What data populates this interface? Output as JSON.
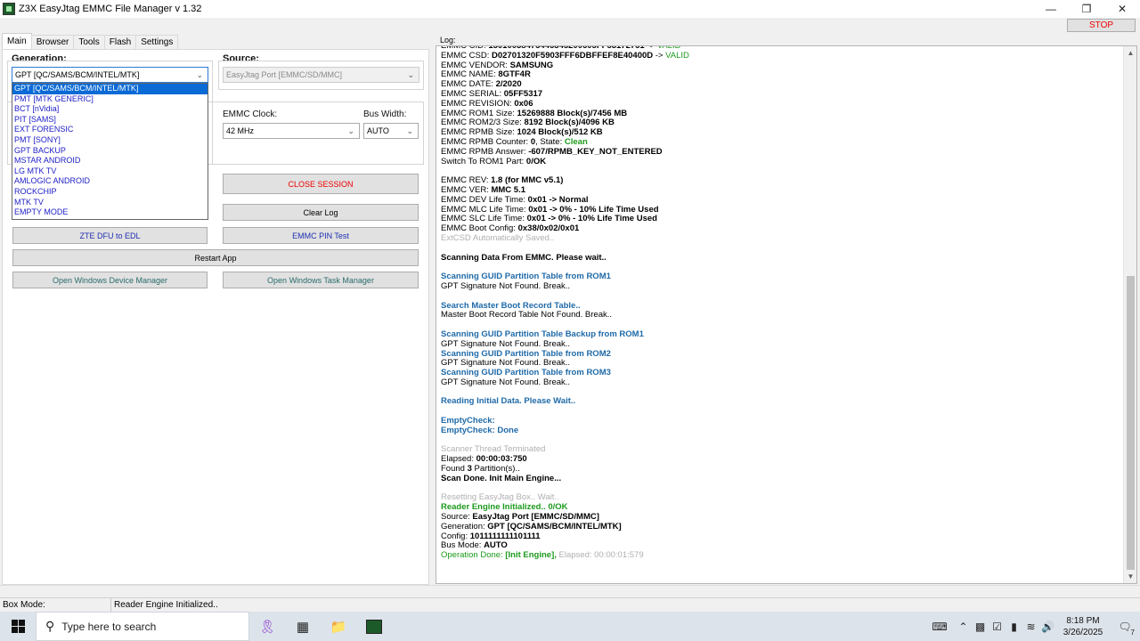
{
  "window": {
    "title": "Z3X EasyJtag EMMC File Manager v 1.32",
    "stop_label": "STOP"
  },
  "tabs": [
    "Main",
    "Browser",
    "Tools",
    "Flash",
    "Settings"
  ],
  "main": {
    "generation_label": "Generation:",
    "generation_value": "GPT [QC/SAMS/BCM/INTEL/MTK]",
    "generation_options": [
      "GPT [QC/SAMS/BCM/INTEL/MTK]",
      "PMT [MTK GENERIC]",
      "BCT [nVidia]",
      "PIT [SAMS]",
      "EXT FORENSIC",
      "PMT [SONY]",
      "GPT BACKUP",
      "MSTAR ANDROID",
      "LG MTK TV",
      "AMLOGIC ANDROID",
      "ROCKCHIP",
      "MTK TV",
      "EMPTY MODE"
    ],
    "source_label": "Source:",
    "source_value": "EasyJtag Port [EMMC/SD/MMC]",
    "emmc_clock_label": "EMMC Clock:",
    "emmc_clock_value": "42 MHz",
    "bus_width_label": "Bus Width:",
    "bus_width_value": "AUTO",
    "buttons": {
      "close_session": "CLOSE SESSION",
      "clear_log": "Clear Log",
      "zte_dfu": "ZTE DFU to EDL",
      "emmc_pin_test": "EMMC PIN Test",
      "restart_app": "Restart App",
      "device_manager": "Open Windows Device Manager",
      "task_manager": "Open Windows Task Manager"
    }
  },
  "log": {
    "label": "Log:",
    "lines": [
      {
        "k": "EMMC CID: ",
        "v": "15010038475446345200605FF53172751",
        "s": " -> ",
        "e": "VALID"
      },
      {
        "k": "EMMC CSD: ",
        "v": "D02701320F5903FFF6DBFFEF8E40400D",
        "s": " -> ",
        "e": "VALID"
      },
      {
        "k": "EMMC VENDOR: ",
        "v": "SAMSUNG"
      },
      {
        "k": "EMMC NAME: ",
        "v": "8GTF4R"
      },
      {
        "k": "EMMC DATE: ",
        "v": "2/2020"
      },
      {
        "k": "EMMC SERIAL: ",
        "v": "05FF5317"
      },
      {
        "k": "EMMC REVISION: ",
        "v": "0x06"
      },
      {
        "k": "EMMC ROM1 Size: ",
        "v": "15269888 Block(s)/7456 MB"
      },
      {
        "k": "EMMC ROM2/3 Size: ",
        "v": "8192 Block(s)/4096 KB"
      },
      {
        "k": "EMMC RPMB Size: ",
        "v": "1024 Block(s)/512 KB"
      },
      {
        "k": "EMMC RPMB Counter: ",
        "v": "0",
        "s": ", State: ",
        "g": "Clean"
      },
      {
        "k": "EMMC RPMB Answer: ",
        "v": "-607/RPMB_KEY_NOT_ENTERED"
      },
      {
        "k": "Switch To ROM1 Part: ",
        "v": "0/OK"
      },
      {
        "k": ""
      },
      {
        "k": "EMMC REV: ",
        "v": "1.8 (for MMC v5.1)"
      },
      {
        "k": "EMMC VER: ",
        "v": "MMC 5.1"
      },
      {
        "k": "EMMC DEV Life Time: ",
        "v": "0x01 -> Normal"
      },
      {
        "k": "EMMC MLC Life Time: ",
        "v": "0x01 -> 0% - 10% Life Time Used"
      },
      {
        "k": "EMMC SLC Life Time: ",
        "v": "0x01 -> 0% - 10% Life Time Used"
      },
      {
        "k": "EMMC Boot Config: ",
        "v": "0x38/0x02/0x01"
      },
      {
        "gray": "ExtCSD Automatically Saved.."
      },
      {
        "k": ""
      },
      {
        "bold": "Scanning Data From EMMC. Please wait.."
      },
      {
        "k": ""
      },
      {
        "blue": "Scanning GUID Partition Table from ROM1"
      },
      {
        "k": "GPT Signature Not Found. Break.."
      },
      {
        "k": ""
      },
      {
        "blue": "Search Master Boot Record Table.."
      },
      {
        "k": "Master Boot Record Table Not Found. Break.."
      },
      {
        "k": ""
      },
      {
        "blue": "Scanning GUID Partition Table Backup from ROM1"
      },
      {
        "k": "GPT Signature Not Found. Break.."
      },
      {
        "blue": "Scanning GUID Partition Table from ROM2"
      },
      {
        "k": "GPT Signature Not Found. Break.."
      },
      {
        "blue": "Scanning GUID Partition Table from ROM3"
      },
      {
        "k": "GPT Signature Not Found. Break.."
      },
      {
        "k": ""
      },
      {
        "blue": "Reading Initial Data. Please Wait.."
      },
      {
        "k": ""
      },
      {
        "blue": "EmptyCheck:"
      },
      {
        "blue": "EmptyCheck: Done"
      },
      {
        "k": ""
      },
      {
        "gray": "Scanner Thread Terminated"
      },
      {
        "k": "Elapsed: ",
        "v": "00:00:03:750"
      },
      {
        "k": "Found ",
        "v": "3",
        "s": " Partition(s).."
      },
      {
        "bold": "Scan Done. Init Main Engine..."
      },
      {
        "k": ""
      },
      {
        "gray": "Resetting EasyJtag Box.. Wait.."
      },
      {
        "greenb": "Reader Engine Initialized.. 0/OK"
      },
      {
        "k": "Source: ",
        "v": "EasyJtag Port [EMMC/SD/MMC]"
      },
      {
        "k": "Generation: ",
        "v": "GPT [QC/SAMS/BCM/INTEL/MTK]"
      },
      {
        "k": "Config: ",
        "v": "1011111111101111"
      },
      {
        "k": "Bus Mode: ",
        "v": "AUTO"
      },
      {
        "green": "Operation Done: ",
        "greenb": "[Init Engine],",
        "gray": " Elapsed: 00:00:01:579"
      }
    ]
  },
  "status": {
    "box_mode_label": "Box Mode:",
    "message": "Reader Engine Initialized.."
  },
  "taskbar": {
    "search_placeholder": "Type here to search",
    "time": "8:18 PM",
    "date": "3/26/2025",
    "notification_count": "7"
  }
}
